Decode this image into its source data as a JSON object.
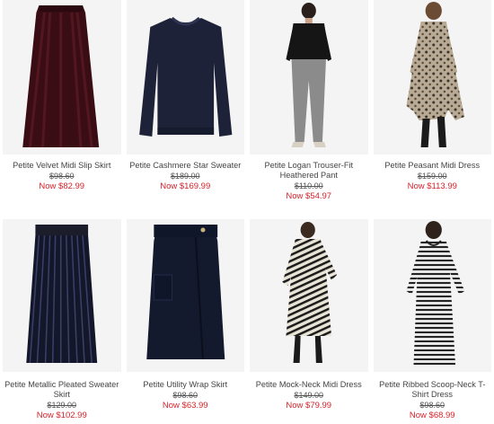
{
  "products": [
    {
      "name": "Petite Velvet Midi Slip Skirt",
      "old_price": "$98.60",
      "now_price": "Now $82.99",
      "image_icon": "velvet-skirt-image"
    },
    {
      "name": "Petite Cashmere Star Sweater",
      "old_price": "$189.00",
      "now_price": "Now $169.99",
      "image_icon": "sweater-image"
    },
    {
      "name": "Petite Logan Trouser-Fit Heathered Pant",
      "old_price": "$110.00",
      "now_price": "Now $54.97",
      "image_icon": "trouser-image"
    },
    {
      "name": "Petite Peasant Midi Dress",
      "old_price": "$159.00",
      "now_price": "Now $113.99",
      "image_icon": "peasant-dress-image"
    },
    {
      "name": "Petite Metallic Pleated Sweater Skirt",
      "old_price": "$129.00",
      "now_price": "Now $102.99",
      "image_icon": "pleated-skirt-image"
    },
    {
      "name": "Petite Utility Wrap Skirt",
      "old_price": "$98.60",
      "now_price": "Now $63.99",
      "image_icon": "wrap-skirt-image"
    },
    {
      "name": "Petite Mock-Neck Midi Dress",
      "old_price": "$149.00",
      "now_price": "Now $79.99",
      "image_icon": "mock-neck-dress-image"
    },
    {
      "name": "Petite Ribbed Scoop-Neck T-Shirt Dress",
      "old_price": "$98.60",
      "now_price": "Now $68.99",
      "image_icon": "tshirt-dress-image"
    }
  ],
  "colors": {
    "sale_red": "#d6232a",
    "image_bg": "#f2f2f2"
  }
}
